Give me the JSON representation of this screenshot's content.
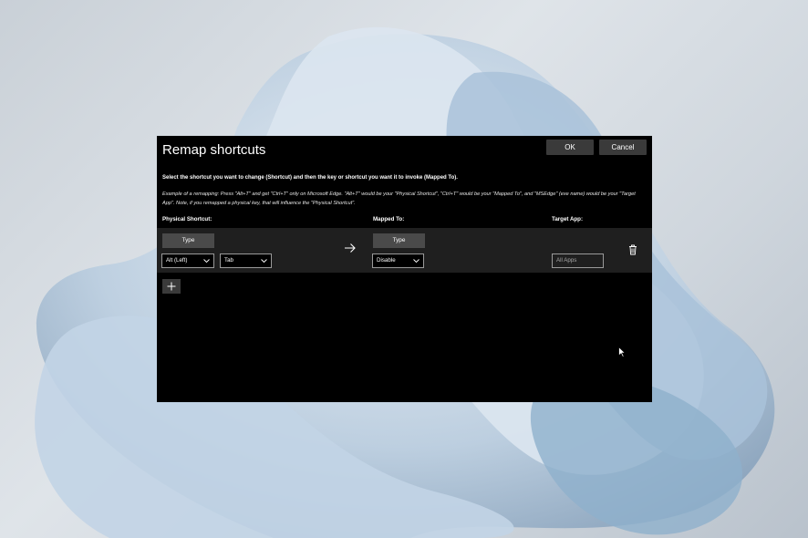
{
  "dialog": {
    "title": "Remap shortcuts",
    "ok_label": "OK",
    "cancel_label": "Cancel",
    "instruction": "Select the shortcut you want to change (Shortcut) and then the key or shortcut you want it to invoke (Mapped To).",
    "example": "Example of a remapping: Press \"Alt+T\" and get \"Ctrl+T\" only on Microsoft Edge. \"Alt+T\" would be your \"Physical Shortcut\", \"Ctrl+T\" would be your \"Mapped To\", and \"MSEdge\" (exe name) would be your \"Target App\". Note, if you remapped a physical key, that will influence the \"Physical Shortcut\".",
    "columns": {
      "physical": "Physical Shortcut:",
      "mapped": "Mapped To:",
      "target": "Target App:"
    },
    "row": {
      "physical_type_label": "Type",
      "physical_key1": "Alt (Left)",
      "physical_key2": "Tab",
      "mapped_type_label": "Type",
      "mapped_value": "Disable",
      "target_placeholder": "All Apps"
    }
  },
  "icons": {
    "arrow": "arrow-right-icon",
    "delete": "trash-icon",
    "add": "plus-icon",
    "chevron": "chevron-down-icon"
  }
}
